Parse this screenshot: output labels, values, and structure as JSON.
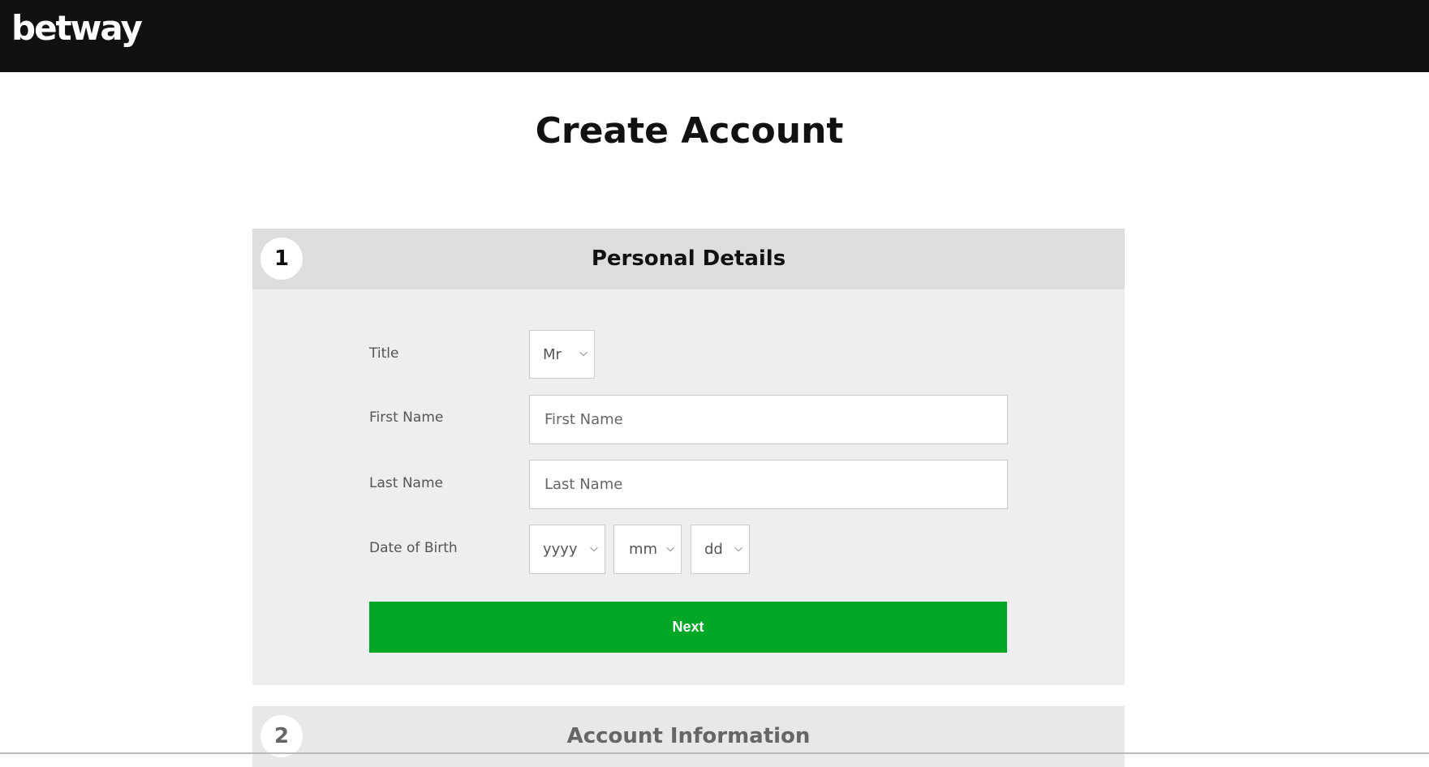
{
  "header": {
    "logo": "betway"
  },
  "page_title": "Create Account",
  "sections": [
    {
      "number": "1",
      "title": "Personal Details"
    },
    {
      "number": "2",
      "title": "Account Information"
    }
  ],
  "form": {
    "title_label": "Title",
    "title_value": "Mr",
    "first_name_label": "First Name",
    "first_name_placeholder": "First Name",
    "last_name_label": "Last Name",
    "last_name_placeholder": "Last Name",
    "dob_label": "Date of Birth",
    "dob_year": "yyyy",
    "dob_month": "mm",
    "dob_day": "dd",
    "next_label": "Next"
  },
  "colors": {
    "accent": "#00a826",
    "header_bg": "#111111"
  }
}
